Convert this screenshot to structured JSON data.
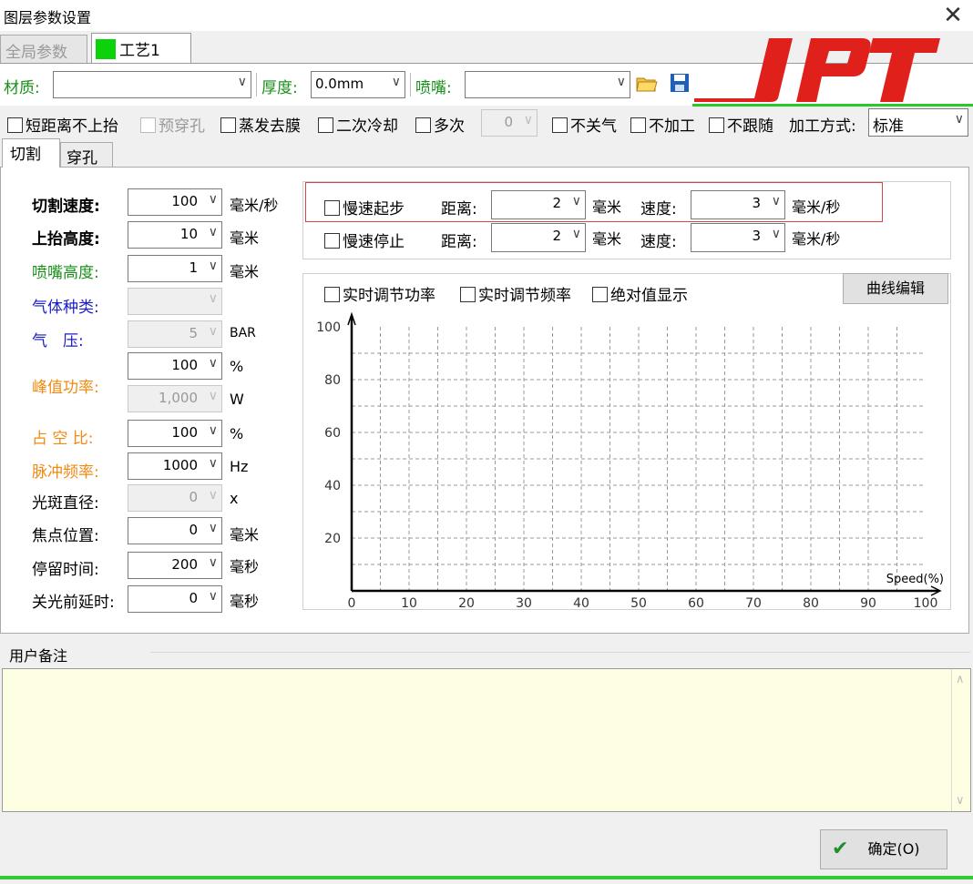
{
  "window": {
    "title": "图层参数设置"
  },
  "tabs": [
    {
      "label": "全局参数"
    },
    {
      "label": "工艺1",
      "color": "#0bd20b"
    }
  ],
  "brand": {
    "logo": "JPT",
    "color": "#e0201a"
  },
  "top": {
    "material_label": "材质:",
    "material_value": "",
    "thickness_label": "厚度:",
    "thickness_value": "0.0mm",
    "nozzle_label": "喷嘴:",
    "nozzle_value": ""
  },
  "options": {
    "short_no_lift": "短距离不上抬",
    "pre_pierce": "预穿孔",
    "evaporate_film": "蒸发去膜",
    "second_cooling": "二次冷却",
    "multi": "多次",
    "multi_count": "0",
    "no_gas_off": "不关气",
    "no_process": "不加工",
    "no_follow": "不跟随",
    "mode_label": "加工方式:",
    "mode_value": "标准"
  },
  "subtabs": [
    "切割",
    "穿孔"
  ],
  "params": [
    {
      "label": "切割速度:",
      "value": "100",
      "unit": "毫米/秒"
    },
    {
      "label": "上抬高度:",
      "value": "10",
      "unit": "毫米"
    },
    {
      "label": "喷嘴高度:",
      "value": "1",
      "unit": "毫米"
    },
    {
      "label": "气体种类:",
      "value": "",
      "unit": ""
    },
    {
      "label": "气　压:",
      "value": "5",
      "unit": "BAR"
    },
    {
      "label": "峰值功率:",
      "value": "100",
      "unit": "%",
      "value2": "1,000",
      "unit2": "W"
    },
    {
      "label": "占 空 比:",
      "value": "100",
      "unit": "%"
    },
    {
      "label": "脉冲频率:",
      "value": "1000",
      "unit": "Hz"
    },
    {
      "label": "光斑直径:",
      "value": "0",
      "unit": "x"
    },
    {
      "label": "焦点位置:",
      "value": "0",
      "unit": "毫米"
    },
    {
      "label": "停留时间:",
      "value": "200",
      "unit": "毫秒"
    },
    {
      "label": "关光前延时:",
      "value": "0",
      "unit": "毫秒"
    }
  ],
  "slow": {
    "start_label": "慢速起步",
    "stop_label": "慢速停止",
    "distance_label": "距离:",
    "speed_label": "速度:",
    "start_distance": "2",
    "start_speed": "3",
    "stop_distance": "2",
    "stop_speed": "3",
    "distance_unit": "毫米",
    "speed_unit": "毫米/秒"
  },
  "realtime": {
    "power": "实时调节功率",
    "frequency": "实时调节频率",
    "absolute": "绝对值显示",
    "curve_button": "曲线编辑"
  },
  "chart_data": {
    "type": "line",
    "title": "",
    "xlabel": "Speed(%)",
    "ylabel": "",
    "xlim": [
      0,
      100
    ],
    "ylim": [
      0,
      100
    ],
    "x_ticks": [
      "0",
      "10",
      "20",
      "30",
      "40",
      "50",
      "60",
      "70",
      "80",
      "90",
      "100"
    ],
    "y_ticks": [
      "20",
      "40",
      "60",
      "80",
      "100"
    ],
    "grid": true,
    "series": []
  },
  "notes": {
    "label": "用户备注",
    "value": ""
  },
  "footer": {
    "ok_label": "确定(O)"
  }
}
